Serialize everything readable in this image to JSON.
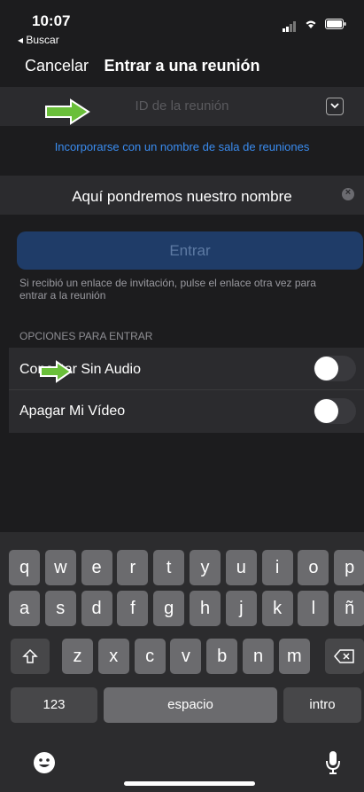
{
  "status_bar": {
    "time": "10:07",
    "back_app": "◂ Buscar"
  },
  "nav": {
    "cancel": "Cancelar",
    "title": "Entrar a una reunión"
  },
  "meeting_id": {
    "placeholder": "ID de la reunión"
  },
  "join_with_room_name": "Incorporarse con un nombre de sala de reuniones",
  "name_field": {
    "value": "Aquí pondremos nuestro nombre"
  },
  "enter_button": "Entrar",
  "hint": "Si recibió un enlace de invitación, pulse el enlace otra vez para entrar a la reunión",
  "options": {
    "header": "OPCIONES PARA ENTRAR",
    "items": [
      {
        "label": "Conectar Sin Audio",
        "enabled": false
      },
      {
        "label": "Apagar Mi Vídeo",
        "enabled": false
      }
    ]
  },
  "keyboard": {
    "row1": [
      "q",
      "w",
      "e",
      "r",
      "t",
      "y",
      "u",
      "i",
      "o",
      "p"
    ],
    "row2": [
      "a",
      "s",
      "d",
      "f",
      "g",
      "h",
      "j",
      "k",
      "l",
      "ñ"
    ],
    "row3": [
      "z",
      "x",
      "c",
      "v",
      "b",
      "n",
      "m"
    ],
    "numbers_key": "123",
    "space_key": "espacio",
    "return_key": "intro"
  },
  "colors": {
    "link": "#3a8cf0",
    "enter_bg": "#1f3c68",
    "arrow": "#6abf3a"
  }
}
